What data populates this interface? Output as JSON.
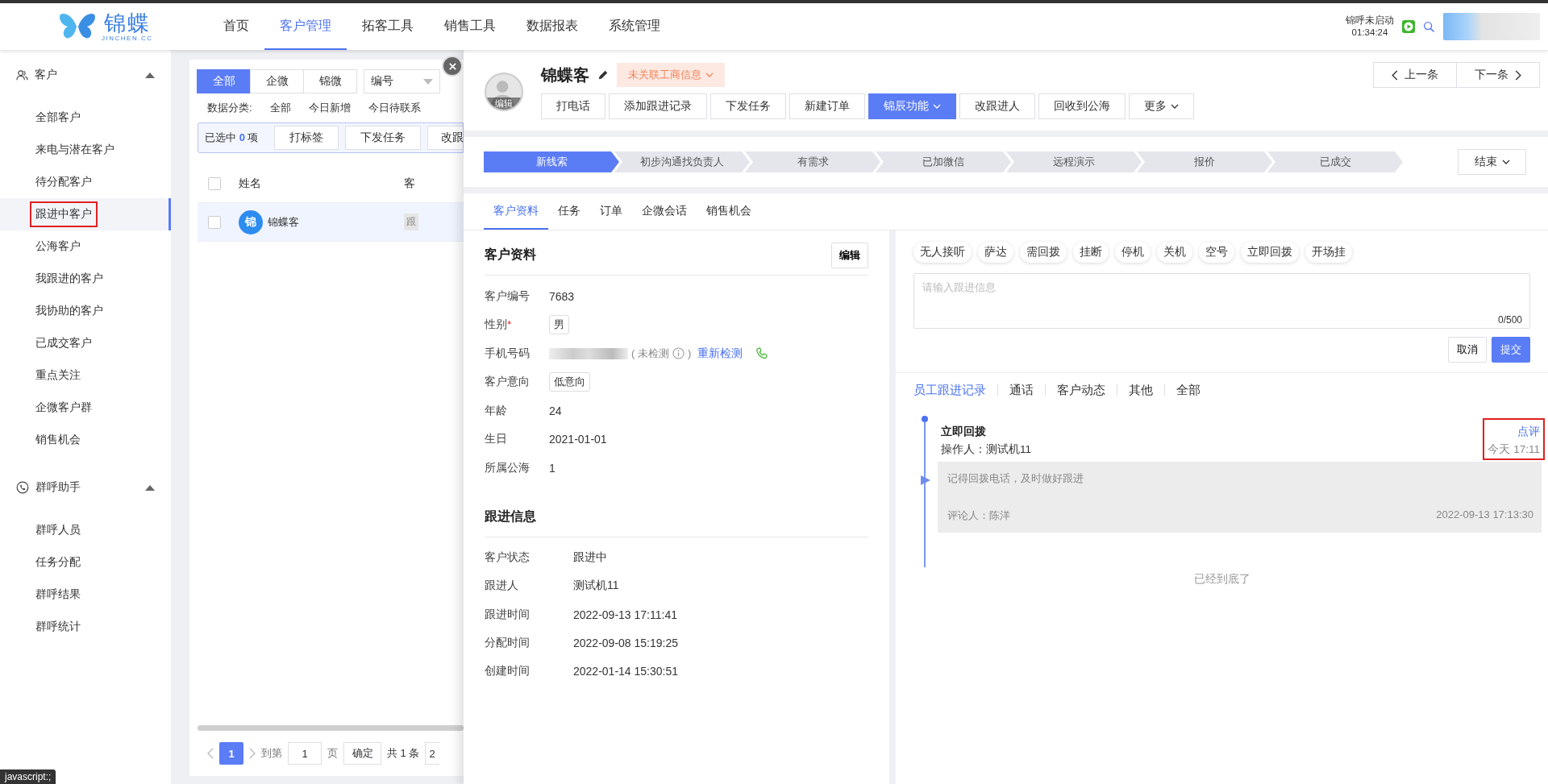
{
  "header": {
    "logo": {
      "name": "锦蝶",
      "domain": "JINCHEN.CC"
    },
    "nav": [
      {
        "label": "首页",
        "selected": false
      },
      {
        "label": "客户管理",
        "selected": true
      },
      {
        "label": "拓客工具",
        "selected": false
      },
      {
        "label": "销售工具",
        "selected": false
      },
      {
        "label": "数据报表",
        "selected": false
      },
      {
        "label": "系统管理",
        "selected": false
      }
    ],
    "call_status": {
      "status": "锦呼未启动",
      "timer": "01:34:24"
    }
  },
  "sidebar": {
    "groups": [
      {
        "kind": "customers",
        "label": "客户",
        "expanded": true,
        "items": [
          {
            "label": "全部客户",
            "selected": false,
            "annotated": false
          },
          {
            "label": "来电与潜在客户",
            "selected": false,
            "annotated": false
          },
          {
            "label": "待分配客户",
            "selected": false,
            "annotated": false
          },
          {
            "label": "跟进中客户",
            "selected": true,
            "annotated": true
          },
          {
            "label": "公海客户",
            "selected": false,
            "annotated": false
          },
          {
            "label": "我跟进的客户",
            "selected": false,
            "annotated": false
          },
          {
            "label": "我协助的客户",
            "selected": false,
            "annotated": false
          },
          {
            "label": "已成交客户",
            "selected": false,
            "annotated": false
          },
          {
            "label": "重点关注",
            "selected": false,
            "annotated": false
          },
          {
            "label": "企微客户群",
            "selected": false,
            "annotated": false
          },
          {
            "label": "销售机会",
            "selected": false,
            "annotated": false
          }
        ]
      },
      {
        "kind": "calls",
        "label": "群呼助手",
        "expanded": true,
        "items": [
          {
            "label": "群呼人员",
            "selected": false,
            "annotated": false
          },
          {
            "label": "任务分配",
            "selected": false,
            "annotated": false
          },
          {
            "label": "群呼结果",
            "selected": false,
            "annotated": false
          },
          {
            "label": "群呼统计",
            "selected": false,
            "annotated": false
          }
        ]
      }
    ]
  },
  "list": {
    "source_tabs": [
      {
        "label": "全部",
        "selected": true
      },
      {
        "label": "企微",
        "selected": false
      },
      {
        "label": "锦微",
        "selected": false
      }
    ],
    "sort_field": {
      "value": "编号"
    },
    "category_label": "数据分类:",
    "categories": [
      "全部",
      "今日新增",
      "今日待联系"
    ],
    "selection": {
      "prefix": "已选中",
      "count": "0",
      "suffix": "项",
      "actions": [
        "打标签",
        "下发任务",
        "改跟"
      ]
    },
    "table": {
      "all_checked": false,
      "columns": [
        "姓名",
        "客"
      ],
      "rows": [
        {
          "checked": false,
          "avatar": "锦",
          "name": "锦蝶客",
          "column_3": "跟"
        }
      ]
    },
    "pagination": {
      "pages": [
        {
          "label": "1",
          "selected": true
        }
      ],
      "goto_label": "到第",
      "goto_value": "1",
      "page_unit": "页",
      "confirm": "确定",
      "total": "共 1 条",
      "page_size": "2"
    }
  },
  "status_tooltip": "javascript:;",
  "drawer": {
    "customer": {
      "name": "锦蝶客",
      "avatar_label": "编辑",
      "business_tag": "未关联工商信息"
    },
    "actions": [
      {
        "label": "打电话",
        "kind": "plain"
      },
      {
        "label": "添加跟进记录",
        "kind": "plain"
      },
      {
        "label": "下发任务",
        "kind": "plain"
      },
      {
        "label": "新建订单",
        "kind": "plain"
      },
      {
        "label": "锦辰功能",
        "kind": "featured"
      },
      {
        "label": "改跟进人",
        "kind": "plain"
      },
      {
        "label": "回收到公海",
        "kind": "plain"
      },
      {
        "label": "更多",
        "kind": "dropdown"
      }
    ],
    "pager": [
      "上一条",
      "下一条"
    ],
    "stages": [
      {
        "label": "新线索",
        "selected": true
      },
      {
        "label": "初步沟通找负责人",
        "selected": false
      },
      {
        "label": "有需求",
        "selected": false
      },
      {
        "label": "已加微信",
        "selected": false
      },
      {
        "label": "远程演示",
        "selected": false
      },
      {
        "label": "报价",
        "selected": false
      },
      {
        "label": "已成交",
        "selected": false
      }
    ],
    "stage_end": "结束",
    "tabs": [
      {
        "label": "客户资料",
        "selected": true
      },
      {
        "label": "任务",
        "selected": false
      },
      {
        "label": "订单",
        "selected": false
      },
      {
        "label": "企微会话",
        "selected": false
      },
      {
        "label": "销售机会",
        "selected": false
      }
    ],
    "profile": {
      "title": "客户资料",
      "edit": "编辑",
      "fields": [
        {
          "kind": "text",
          "label": "客户编号",
          "value": "7683"
        },
        {
          "kind": "tag",
          "label": "性别",
          "required_mark": "*",
          "value": "男"
        },
        {
          "kind": "phone",
          "label": "手机号码",
          "status": "( 未检测",
          "status_end": ")",
          "recheck": "重新检测"
        },
        {
          "kind": "tag",
          "label": "客户意向",
          "value": "低意向"
        },
        {
          "kind": "text",
          "label": "年龄",
          "value": "24"
        },
        {
          "kind": "text",
          "label": "生日",
          "value": "2021-01-01"
        },
        {
          "kind": "text",
          "label": "所属公海",
          "value": "1"
        }
      ]
    },
    "followup": {
      "title": "跟进信息",
      "fields": [
        {
          "label": "客户状态",
          "value": "跟进中"
        },
        {
          "label": "跟进人",
          "value": "测试机11"
        },
        {
          "label": "跟进时间",
          "value": "2022-09-13 17:11:41"
        },
        {
          "label": "分配时间",
          "value": "2022-09-08 15:19:25"
        },
        {
          "label": "创建时间",
          "value": "2022-01-14 15:30:51"
        }
      ]
    },
    "record": {
      "quick_tags": [
        "无人接听",
        "萨达",
        "需回拨",
        "挂断",
        "停机",
        "关机",
        "空号",
        "立即回拨",
        "开场挂"
      ],
      "input": {
        "placeholder": "请输入跟进信息",
        "counter": "0/500"
      },
      "buttons": [
        {
          "label": "取消",
          "kind": "plain"
        },
        {
          "label": "提交",
          "kind": "primary"
        }
      ],
      "filters": [
        {
          "label": "员工跟进记录",
          "selected": true
        },
        {
          "label": "通话",
          "selected": false
        },
        {
          "label": "客户动态",
          "selected": false
        },
        {
          "label": "其他",
          "selected": false
        },
        {
          "label": "全部",
          "selected": false
        }
      ],
      "entries": [
        {
          "title": "立即回拨",
          "operator": "操作人：测试机11",
          "review_link": "点评",
          "time": "今天 17:11",
          "annotated": true,
          "comments": [
            {
              "text": "记得回拨电话，及时做好跟进",
              "author": "评论人：陈洋",
              "time": "2022-09-13 17:13:30"
            }
          ]
        }
      ],
      "end_note": "已经到底了"
    }
  }
}
